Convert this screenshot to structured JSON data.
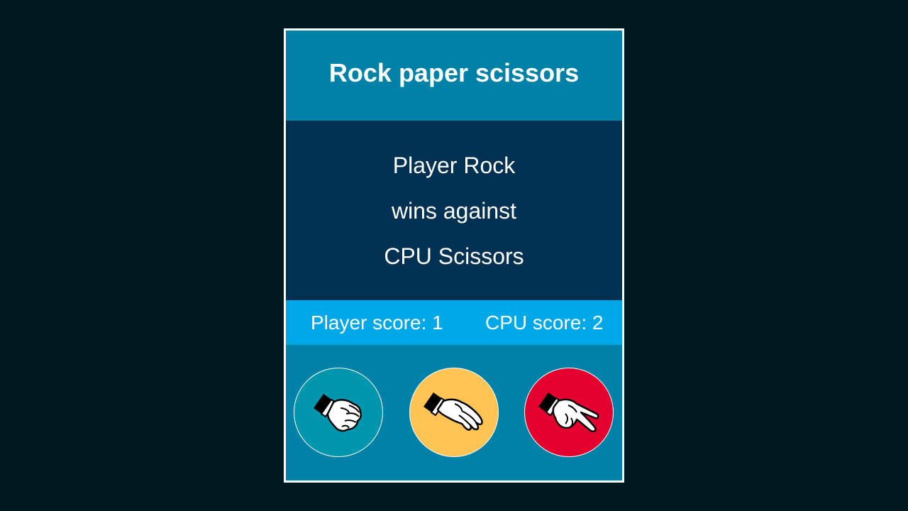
{
  "game": {
    "title": "Rock paper scissors"
  },
  "result": {
    "line1": "Player Rock",
    "line2": "wins against",
    "line3": "CPU Scissors"
  },
  "scores": {
    "player": "Player score: 1",
    "cpu": "CPU score: 2"
  },
  "choices": [
    {
      "name": "rock",
      "icon": "fist-hand-icon",
      "color": "#0096ae"
    },
    {
      "name": "paper",
      "icon": "open-hand-icon",
      "color": "#ffc453"
    },
    {
      "name": "scissors",
      "icon": "peace-hand-icon",
      "color": "#e4002f"
    }
  ],
  "colors": {
    "background": "#001820",
    "header": "#0081a7",
    "result_panel": "#003153",
    "score_bar": "#00a8e8",
    "choices_panel": "#0081a7"
  }
}
